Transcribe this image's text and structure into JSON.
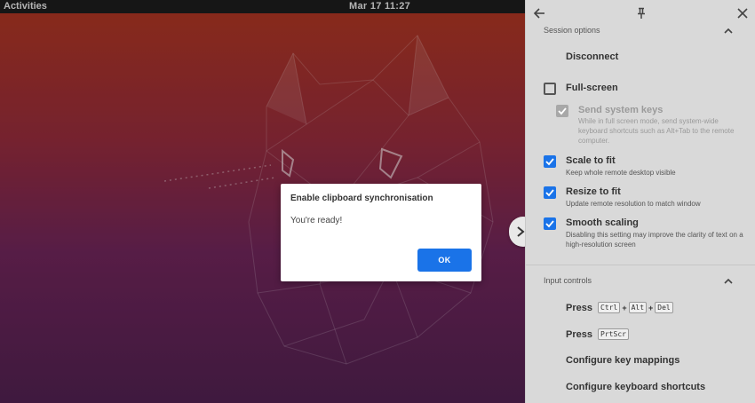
{
  "topbar": {
    "activities": "Activities",
    "clock": "Mar 17  11:27"
  },
  "dialog": {
    "title": "Enable clipboard synchronisation",
    "message": "You're ready!",
    "ok_label": "OK"
  },
  "panel": {
    "session": {
      "header": "Session options",
      "disconnect": "Disconnect",
      "full_screen": {
        "label": "Full-screen",
        "checked": false
      },
      "send_system_keys": {
        "label": "Send system keys",
        "description": "While in full screen mode, send system-wide keyboard shortcuts such as Alt+Tab to the remote computer.",
        "checked": true,
        "disabled": true
      },
      "scale_to_fit": {
        "label": "Scale to fit",
        "description": "Keep whole remote desktop visible",
        "checked": true
      },
      "resize_to_fit": {
        "label": "Resize to fit",
        "description": "Update remote resolution to match window",
        "checked": true
      },
      "smooth_scaling": {
        "label": "Smooth scaling",
        "description": "Disabling this setting may improve the clarity of text on a high-resolution screen",
        "checked": true
      }
    },
    "input": {
      "header": "Input controls",
      "press": "Press",
      "keys_ctrl_alt_del": [
        "Ctrl",
        "Alt",
        "Del"
      ],
      "plus": "+",
      "key_prtscr": "PrtScr",
      "configure_key_mappings": "Configure key mappings",
      "configure_keyboard_shortcuts": "Configure keyboard shortcuts"
    }
  },
  "colors": {
    "accent": "#1a73e8",
    "panel_bg": "#d9d9d9",
    "topbar_bg": "#1b1b1b"
  }
}
